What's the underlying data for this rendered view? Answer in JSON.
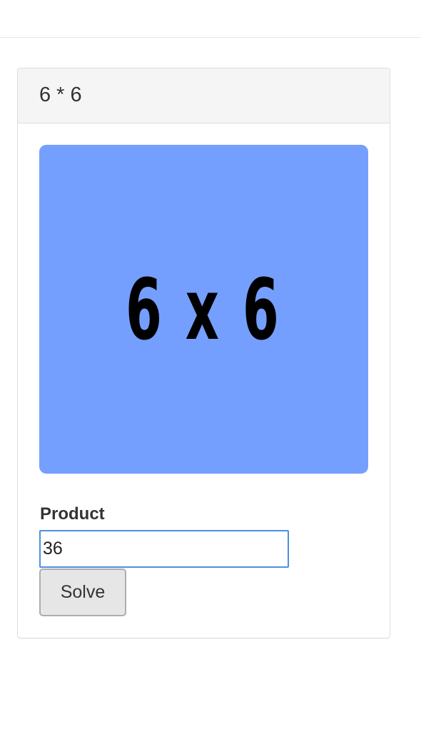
{
  "problem": {
    "heading": "6 * 6",
    "image_text": "6 x 6",
    "image_color": "#759ffe"
  },
  "form": {
    "label": "Product",
    "input_value": "36",
    "button_label": "Solve"
  }
}
